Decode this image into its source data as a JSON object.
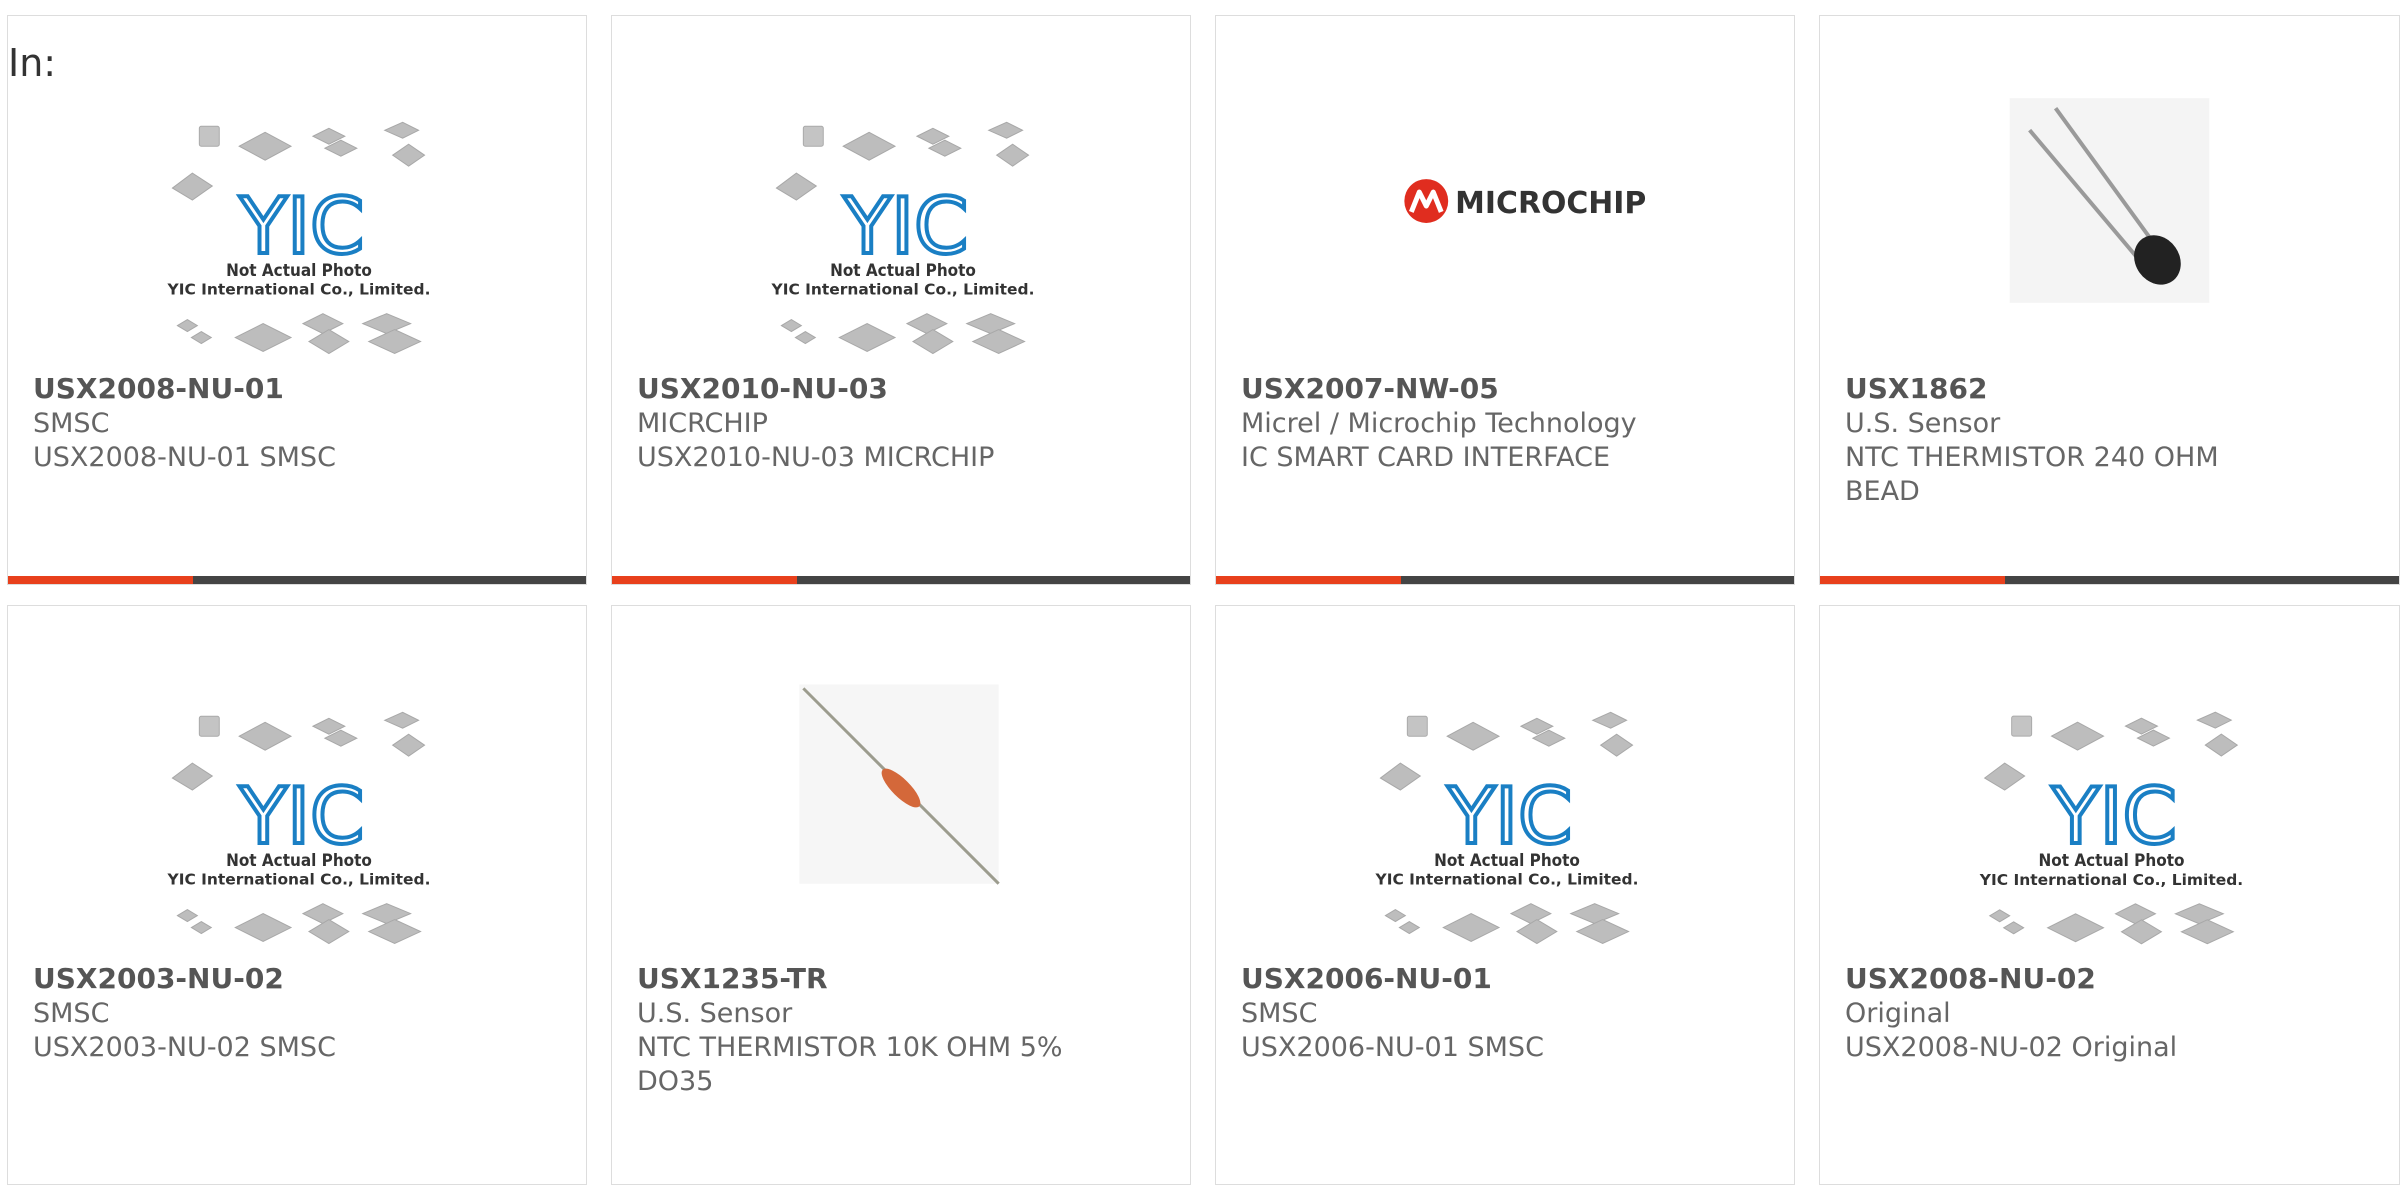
{
  "header": {
    "in_label": "In:"
  },
  "theme": {
    "accent": "#e8401c",
    "bar": "#444444",
    "logo_blue": "#1a7fc4",
    "microchip_red": "#e02d1f"
  },
  "placeholder": {
    "logo_text": "YIC",
    "line1": "Not Actual Photo",
    "line2": "YIC International Co., Limited."
  },
  "microchip": {
    "brand": "MICROCHIP"
  },
  "products": [
    {
      "part": "USX2008-NU-01",
      "manufacturer": "SMSC",
      "description": "USX2008-NU-01 SMSC",
      "image": "placeholder"
    },
    {
      "part": "USX2010-NU-03",
      "manufacturer": "MICRCHIP",
      "description": "USX2010-NU-03 MICRCHIP",
      "image": "placeholder"
    },
    {
      "part": "USX2007-NW-05",
      "manufacturer": "Micrel / Microchip Technology",
      "description": "IC SMART CARD INTERFACE",
      "image": "microchip-logo"
    },
    {
      "part": "USX1862",
      "manufacturer": "U.S. Sensor",
      "description": "NTC THERMISTOR 240 OHM BEAD",
      "image": "thermistor-bead"
    },
    {
      "part": "USX2003-NU-02",
      "manufacturer": "SMSC",
      "description": "USX2003-NU-02 SMSC",
      "image": "placeholder"
    },
    {
      "part": "USX1235-TR",
      "manufacturer": "U.S. Sensor",
      "description": "NTC THERMISTOR 10K OHM 5% DO35",
      "image": "thermistor-axial"
    },
    {
      "part": "USX2006-NU-01",
      "manufacturer": "SMSC",
      "description": "USX2006-NU-01 SMSC",
      "image": "placeholder"
    },
    {
      "part": "USX2008-NU-02",
      "manufacturer": "Original",
      "description": "USX2008-NU-02 Original",
      "image": "placeholder"
    }
  ]
}
